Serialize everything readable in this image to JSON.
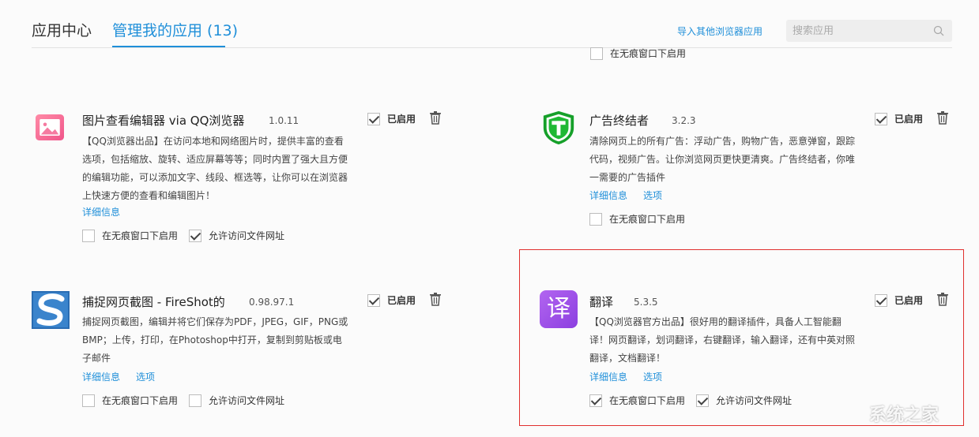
{
  "header": {
    "tab_center": "应用中心",
    "tab_manage": "管理我的应用 (13)",
    "import_link": "导入其他浏览器应用",
    "search_placeholder": "搜索应用"
  },
  "top_partial": {
    "incognito_label": "在无痕窗口下启用",
    "incognito_checked": false
  },
  "apps": [
    {
      "name": "图片查看编辑器 via QQ浏览器",
      "version": "1.0.11",
      "desc": "【QQ浏览器出品】在访问本地和网络图片时，提供丰富的查看选项，包括缩放、旋转、适应屏幕等等；同时内置了强大且方便的编辑功能，可以添加文字、线段、框选等，让你可以在浏览器上快速方便的查看和编辑图片！",
      "enabled_label": "已启用",
      "details": "详细信息",
      "incognito": "在无痕窗口下启用",
      "file_access": "允许访问文件网址"
    },
    {
      "name": "广告终结者",
      "version": "3.2.3",
      "desc": "清除网页上的所有广告：浮动广告，购物广告，恶意弹窗，跟踪代码，视频广告。让你浏览网页更快更清爽。广告终结者，你唯一需要的广告插件",
      "enabled_label": "已启用",
      "details": "详细信息",
      "options": "选项",
      "incognito": "在无痕窗口下启用"
    },
    {
      "name": "捕捉网页截图 - FireShot的",
      "version": "0.98.97.1",
      "desc": "捕捉网页截图，编辑并将它们保存为PDF，JPEG，GIF，PNG或BMP；上传，打印，在Photoshop中打开，复制到剪贴板或电子邮件",
      "enabled_label": "已启用",
      "details": "详细信息",
      "options": "选项",
      "incognito": "在无痕窗口下启用",
      "file_access": "允许访问文件网址"
    },
    {
      "name": "翻译",
      "version": "5.3.5",
      "icon_text": "译",
      "desc": "【QQ浏览器官方出品】很好用的翻译插件，具备人工智能翻译！网页翻译，划词翻译，右键翻译，输入翻译，还有中英对照翻译，文档翻译！",
      "enabled_label": "已启用",
      "details": "详细信息",
      "options": "选项",
      "incognito": "在无痕窗口下启用",
      "file_access": "允许访问文件网址"
    }
  ],
  "colors": {
    "accent": "#1f8fd9",
    "highlight": "#e0302e"
  },
  "watermark": "系统之家"
}
